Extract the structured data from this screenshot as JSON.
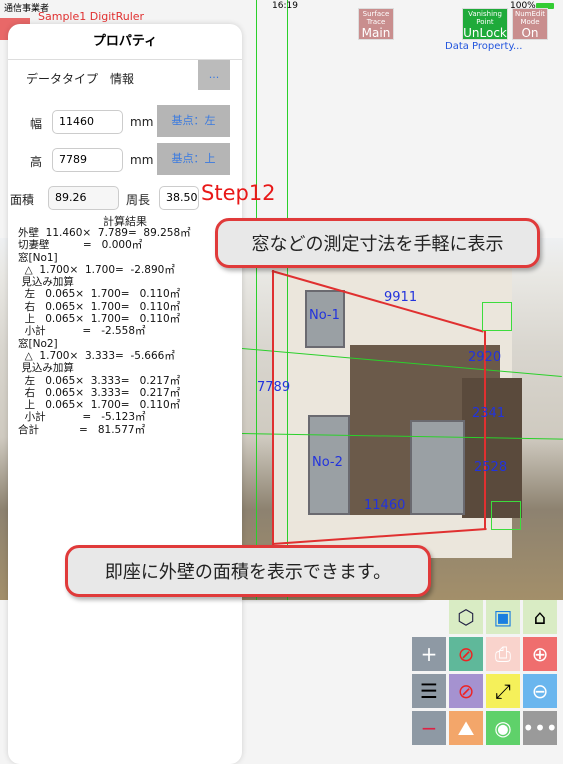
{
  "status_bar": {
    "carrier": "通信事業者",
    "time": "16:19",
    "battery": "100%"
  },
  "app": {
    "doc_title": "Sample1 DigitRuler"
  },
  "mode_buttons": [
    {
      "title": "Surface Trace",
      "value": "Main",
      "color": "#c98e8e"
    },
    {
      "title": "Vanishing Point",
      "value": "UnLock",
      "color": "#1faa3a"
    },
    {
      "title": "NumEdit Mode",
      "value": "On",
      "color": "#c98e8e"
    }
  ],
  "data_property_link": "Data Property...",
  "panel": {
    "title": "プロパティ",
    "datatype_label": "データタイプ",
    "datatype_value": "情報",
    "more_button": "...",
    "width_label": "幅",
    "width_value": "11460",
    "width_unit": "mm",
    "width_anchor": "基点：左",
    "height_label": "高",
    "height_value": "7789",
    "height_unit": "mm",
    "height_anchor": "基点：上",
    "area_label": "面積",
    "area_value": "89.26",
    "perimeter_label": "周長",
    "perimeter_value": "38.50",
    "calc_title": "計算結果",
    "calc_lines": [
      "外壁  11.460×  7.789=  89.258㎡",
      "切妻壁          =   0.000㎡",
      "窓[No1]",
      "  △  1.700×  1.700=  -2.890㎡",
      " 見込み加算",
      "  左   0.065×  1.700=   0.110㎡",
      "  右   0.065×  1.700=   0.110㎡",
      "  上   0.065×  1.700=   0.110㎡",
      "  小計           =   -2.558㎡",
      "窓[No2]",
      "  △  1.700×  3.333=  -5.666㎡",
      " 見込み加算",
      "  左   0.065×  3.333=   0.217㎡",
      "  右   0.065×  3.333=   0.217㎡",
      "  上   0.065×  1.700=   0.110㎡",
      "  小計           =   -5.123㎡",
      "合計            =   81.577㎡"
    ]
  },
  "step_label": "Step12",
  "callouts": [
    "窓などの測定寸法を手軽に表示",
    "即座に外壁の面積を表示できます。"
  ],
  "measure_labels": {
    "width_top": "9911",
    "height_left": "7789",
    "right_upper": "2920",
    "right_mid": "2341",
    "right_lower": "2528",
    "bottom": "11460",
    "window1": "No-1",
    "window2": "No-2",
    "corner": "1370"
  },
  "toolbar": [
    "shape-more",
    "save",
    "home-3d-switch",
    "add-panel",
    "no-search",
    "print",
    "zoom-in",
    "list-panel",
    "no-image",
    "fit-screen",
    "zoom-out",
    "remove-panel",
    "image",
    "camera",
    "more"
  ]
}
